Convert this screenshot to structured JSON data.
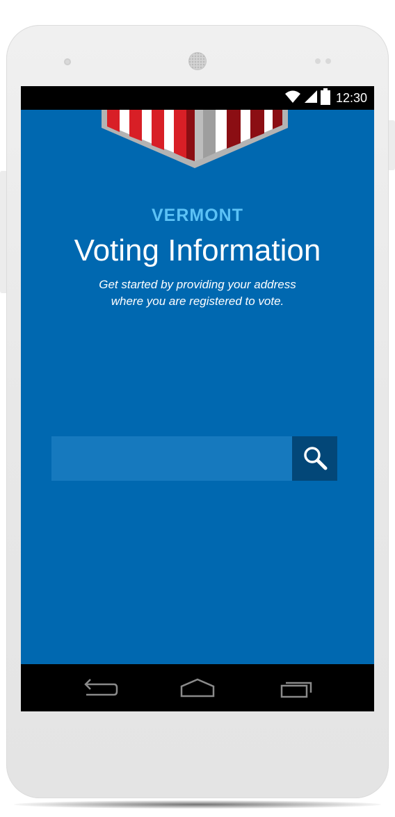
{
  "status_bar": {
    "time": "12:30",
    "icons": [
      "wifi-icon",
      "signal-icon",
      "battery-icon"
    ]
  },
  "header": {
    "state": "VERMONT",
    "title": "Voting Information",
    "subtitle_line1": "Get started by providing your address",
    "subtitle_line2": "where you are registered to vote."
  },
  "search": {
    "value": "",
    "placeholder": "",
    "button_icon": "search-icon"
  },
  "nav_bar": {
    "buttons": [
      "back-icon",
      "home-icon",
      "recent-apps-icon"
    ]
  },
  "colors": {
    "screen_background": "#0068b0",
    "state_label": "#5cc2f6",
    "search_field": "#1679be",
    "search_button": "#034778",
    "banner_red": "#d81f26",
    "banner_gray": "#b3b3b3"
  }
}
